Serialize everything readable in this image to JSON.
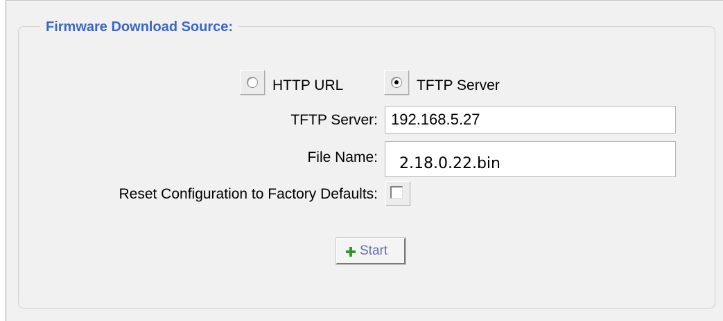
{
  "legend": "Firmware Download Source:",
  "source": {
    "options": [
      {
        "label": "HTTP URL",
        "checked": false
      },
      {
        "label": "TFTP Server",
        "checked": true
      }
    ]
  },
  "fields": {
    "tftp_server_label": "TFTP Server:",
    "tftp_server_value": "192.168.5.27",
    "file_name_label": "File Name:",
    "file_name_value": "2.18.0.22.bin",
    "reset_label": "Reset Configuration to Factory Defaults:",
    "reset_checked": false
  },
  "actions": {
    "start_label": "Start",
    "start_icon": "plus-icon"
  },
  "colors": {
    "legend": "#3a66cc",
    "panel_bg": "#f1f1f1",
    "start_text": "#5f6fb0",
    "start_icon": "#2e9a2e"
  }
}
